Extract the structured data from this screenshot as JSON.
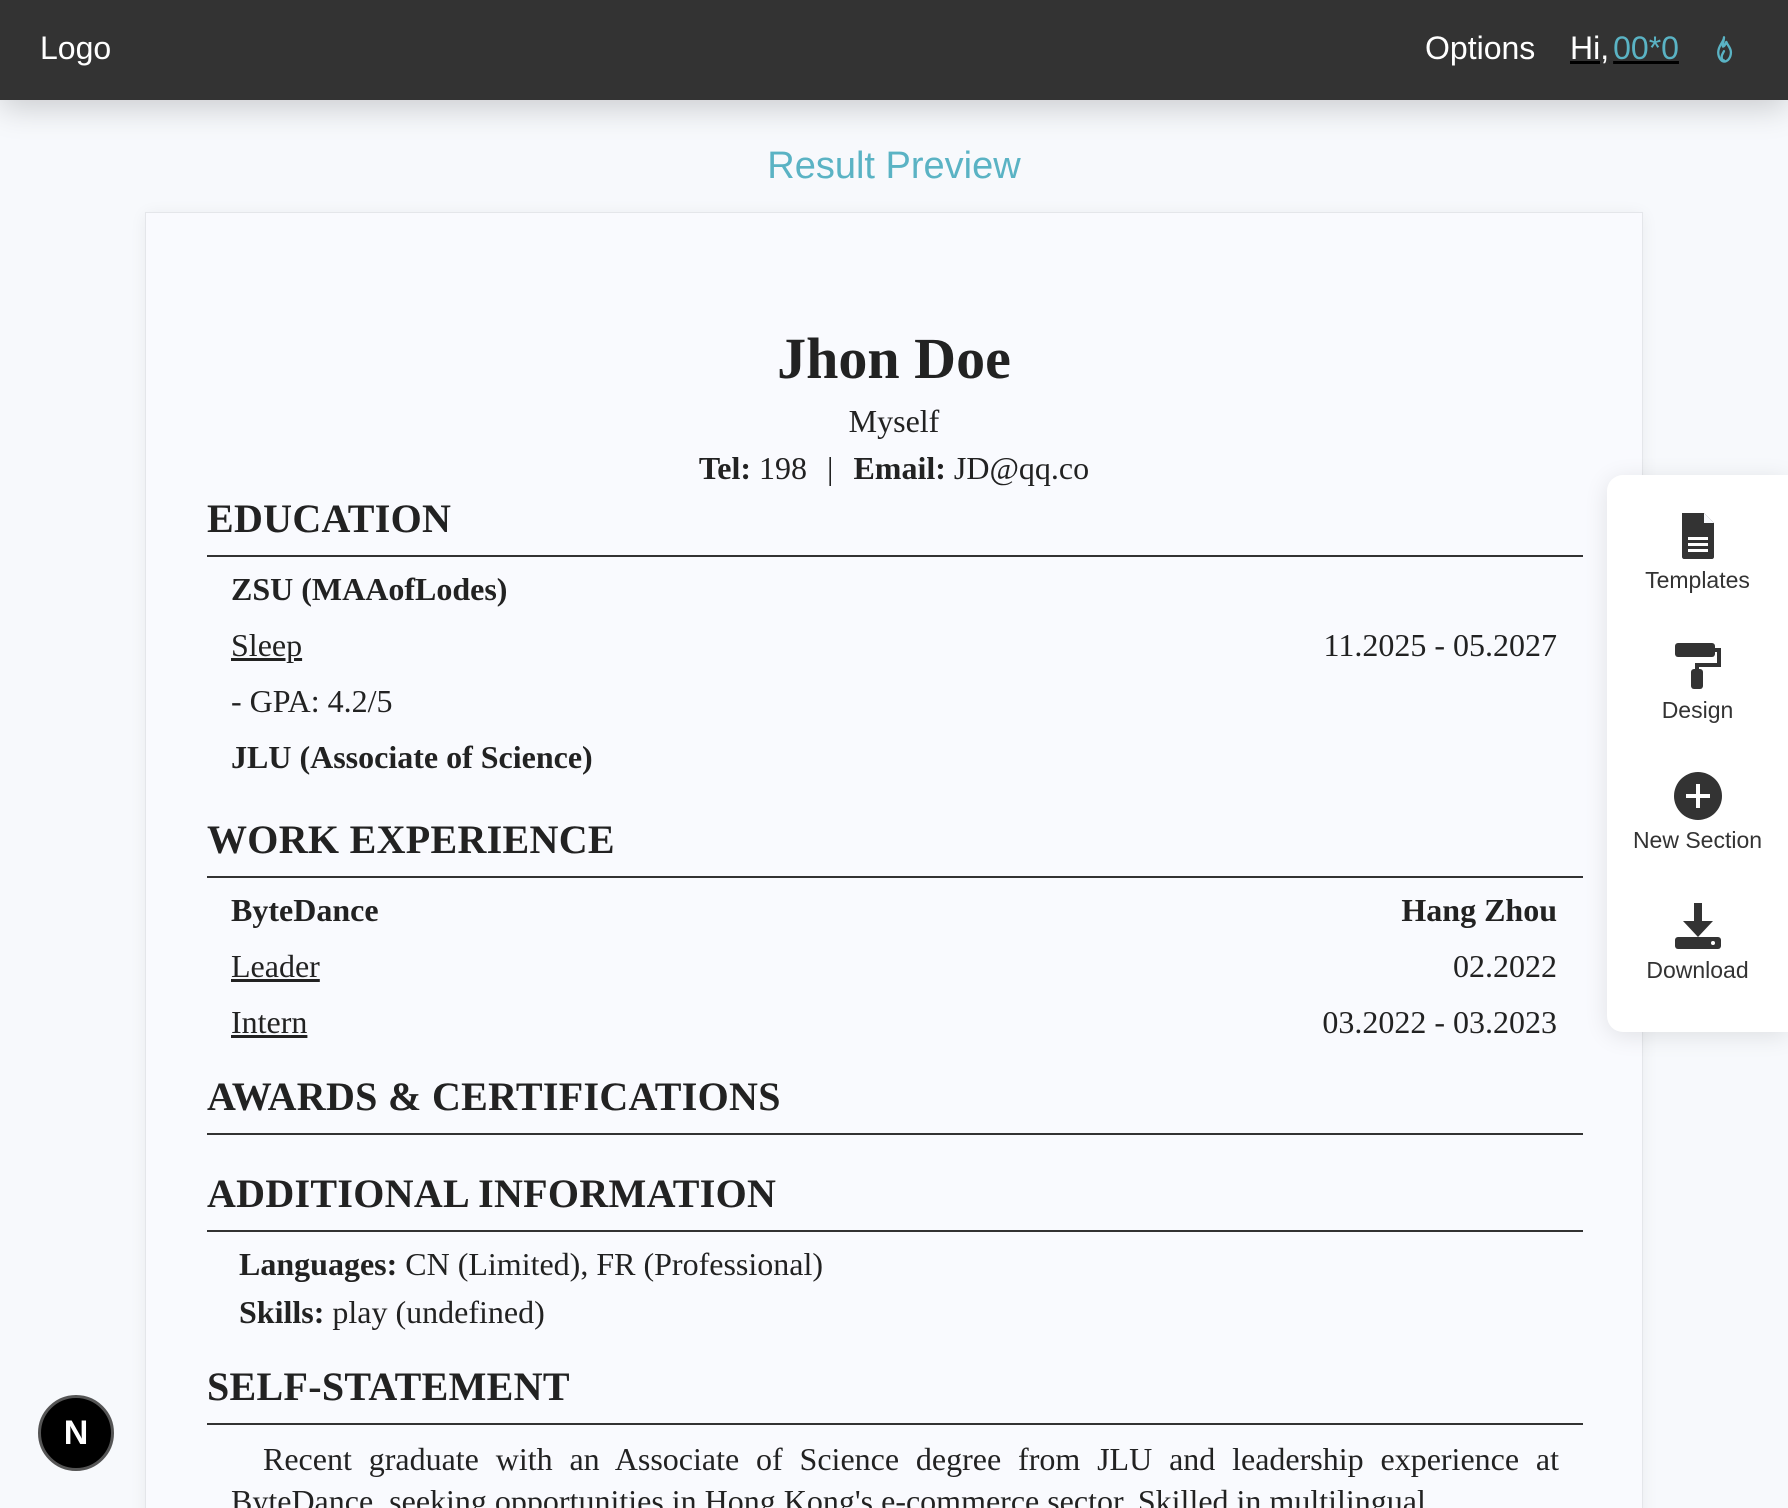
{
  "topbar": {
    "logo": "Logo",
    "options": "Options",
    "greeting": "Hi,",
    "username": "00*0",
    "flame_icon": "flame-icon"
  },
  "page": {
    "title": "Result Preview"
  },
  "resume": {
    "name": "Jhon Doe",
    "tagline": "Myself",
    "tel_label": "Tel:",
    "tel_value": "198",
    "separator": "|",
    "email_label": "Email:",
    "email_value": "JD@qq.co",
    "education": {
      "title": "EDUCATION",
      "school1": "ZSU (MAAofLodes)",
      "major1": "Sleep",
      "dates1": "11.2025 - 05.2027",
      "gpa1": "- GPA: 4.2/5",
      "school2": "JLU (Associate of Science)"
    },
    "work": {
      "title": "WORK EXPERIENCE",
      "company": "ByteDance",
      "location": "Hang Zhou",
      "role1": "Leader",
      "date1": "02.2022",
      "role2": "Intern",
      "date2": "03.2022 - 03.2023"
    },
    "awards": {
      "title": "AWARDS & CERTIFICATIONS"
    },
    "additional": {
      "title": "ADDITIONAL INFORMATION",
      "languages_label": "Languages:",
      "languages_value": "CN (Limited), FR (Professional)",
      "skills_label": "Skills:",
      "skills_value": "play (undefined)"
    },
    "statement": {
      "title": "SELF-STATEMENT",
      "text": "Recent graduate with an Associate of Science degree from JLU and leadership experience at ByteDance, seeking opportunities in Hong Kong's e-commerce sector. Skilled in multilingual"
    }
  },
  "sidebar": {
    "templates": "Templates",
    "design": "Design",
    "new_section": "New Section",
    "download": "Download"
  },
  "badge": {
    "letter": "N"
  }
}
